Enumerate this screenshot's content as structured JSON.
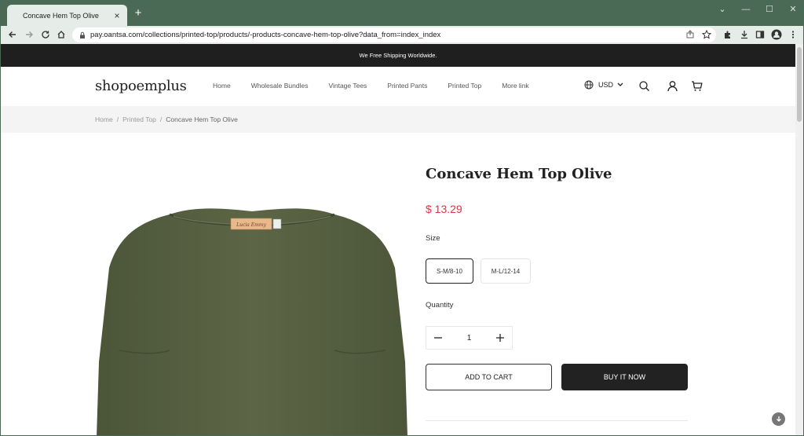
{
  "browser": {
    "tab_title": "Concave Hem Top Olive",
    "tab_close": "×",
    "new_tab": "+",
    "url": "pay.oantsa.com/collections/printed-top/products/-products-concave-hem-top-olive?data_from=index_index",
    "window_controls": [
      "⌄",
      "—",
      "☐",
      "✕"
    ]
  },
  "announcement": "We Free Shipping Worldwide.",
  "header": {
    "logo": "shopoemplus",
    "nav": [
      "Home",
      "Wholesale Bundles",
      "Vintage Tees",
      "Printed Pants",
      "Printed Top",
      "More link"
    ],
    "currency": "USD"
  },
  "breadcrumb": {
    "home": "Home",
    "sep": "/",
    "category": "Printed Top",
    "current": "Concave Hem Top Olive"
  },
  "product": {
    "title": "Concave Hem Top Olive",
    "price": "$ 13.29",
    "size_label": "Size",
    "sizes": [
      "S-M/8-10",
      "M-L/12-14"
    ],
    "selected_size": "S-M/8-10",
    "quantity_label": "Quantity",
    "quantity": "1",
    "add_to_cart": "ADD TO CART",
    "buy_now": "BUY IT NOW",
    "label_text": "Lucia Emmy",
    "color": "#5a6444"
  },
  "colors": {
    "browser_frame": "#4a6a55",
    "toolbar": "#e6ece8",
    "announcement_bg": "#1f1f1f",
    "price": "#e0313f"
  }
}
